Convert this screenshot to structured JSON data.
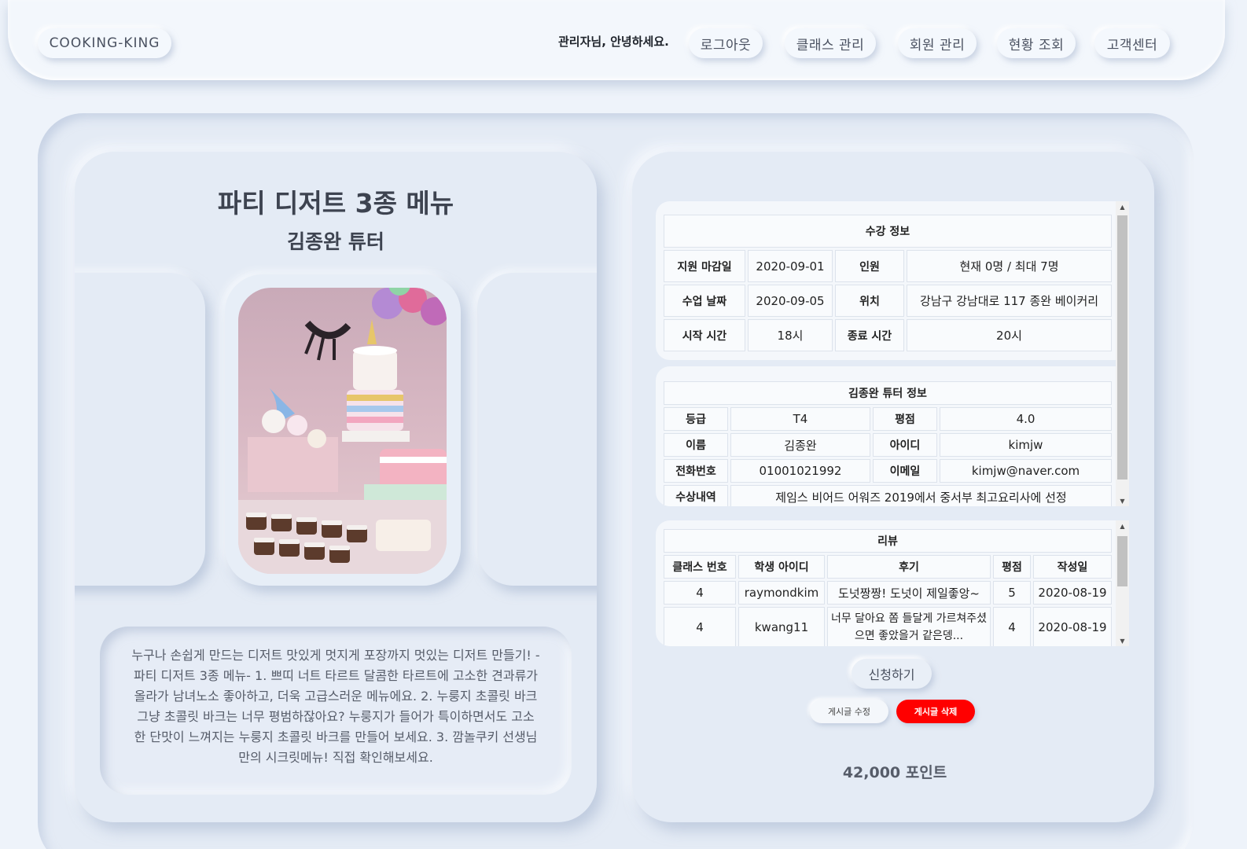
{
  "header": {
    "brand": "COOKING-KING",
    "greeting": "관리자님, 안녕하세요.",
    "nav": {
      "logout": "로그아웃",
      "class_manage": "클래스 관리",
      "member_manage": "회원 관리",
      "status": "현황 조회",
      "support": "고객센터"
    }
  },
  "class": {
    "title": "파티 디저트 3종 메뉴",
    "tutor": "김종완 튜터",
    "description": "누구나 손쉽게 만드는 디저트 맛있게 멋지게 포장까지 멋있는 디저트 만들기! -파티 디저트 3종 메뉴- 1. 쁘띠 너트 타르트 달콤한 타르트에 고소한 견과류가 올라가 남녀노소 좋아하고, 더욱 고급스러운 메뉴에요. 2. 누룽지 초콜릿 바크 그냥 초콜릿 바크는 너무 평범하잖아요? 누룽지가 들어가 특이하면서도 고소한 단맛이 느껴지는 누룽지 초콜릿 바크를 만들어 보세요. 3. 깜놀쿠키 선생님만의 시크릿메뉴! 직접 확인해보세요."
  },
  "enrollment": {
    "title": "수강 정보",
    "deadline_label": "지원 마감일",
    "deadline": "2020-09-01",
    "capacity_label": "인원",
    "capacity": "현재 0명 / 최대 7명",
    "date_label": "수업 날짜",
    "date": "2020-09-05",
    "location_label": "위치",
    "location": "강남구 강남대로 117 종완 베이커리",
    "start_label": "시작 시간",
    "start": "18시",
    "end_label": "종료 시간",
    "end": "20시"
  },
  "tutor_info": {
    "title": "김종완 튜터 정보",
    "grade_label": "등급",
    "grade": "T4",
    "rating_label": "평점",
    "rating": "4.0",
    "name_label": "이름",
    "name": "김종완",
    "id_label": "아이디",
    "id": "kimjw",
    "phone_label": "전화번호",
    "phone": "01001021992",
    "email_label": "이메일",
    "email": "kimjw@naver.com",
    "award_label": "수상내역",
    "award": "제임스 비어드 어워즈 2019에서 중서부 최고요리사에 선정"
  },
  "reviews": {
    "title": "리뷰",
    "columns": [
      "클래스 번호",
      "학생 아이디",
      "후기",
      "평점",
      "작성일"
    ],
    "rows": [
      {
        "class_no": "4",
        "student": "raymondkim",
        "review": "도넛짱짱! 도넛이 제일좋앙~",
        "rating": "5",
        "date": "2020-08-19"
      },
      {
        "class_no": "4",
        "student": "kwang11",
        "review": "너무 달아요 쫌 들달게 가르쳐주셨으면 좋았을거 같은뎅...",
        "rating": "4",
        "date": "2020-08-19"
      }
    ]
  },
  "actions": {
    "apply": "신청하기",
    "edit": "게시글 수정",
    "delete": "게시글 삭제"
  },
  "price": "42,000 포인트"
}
